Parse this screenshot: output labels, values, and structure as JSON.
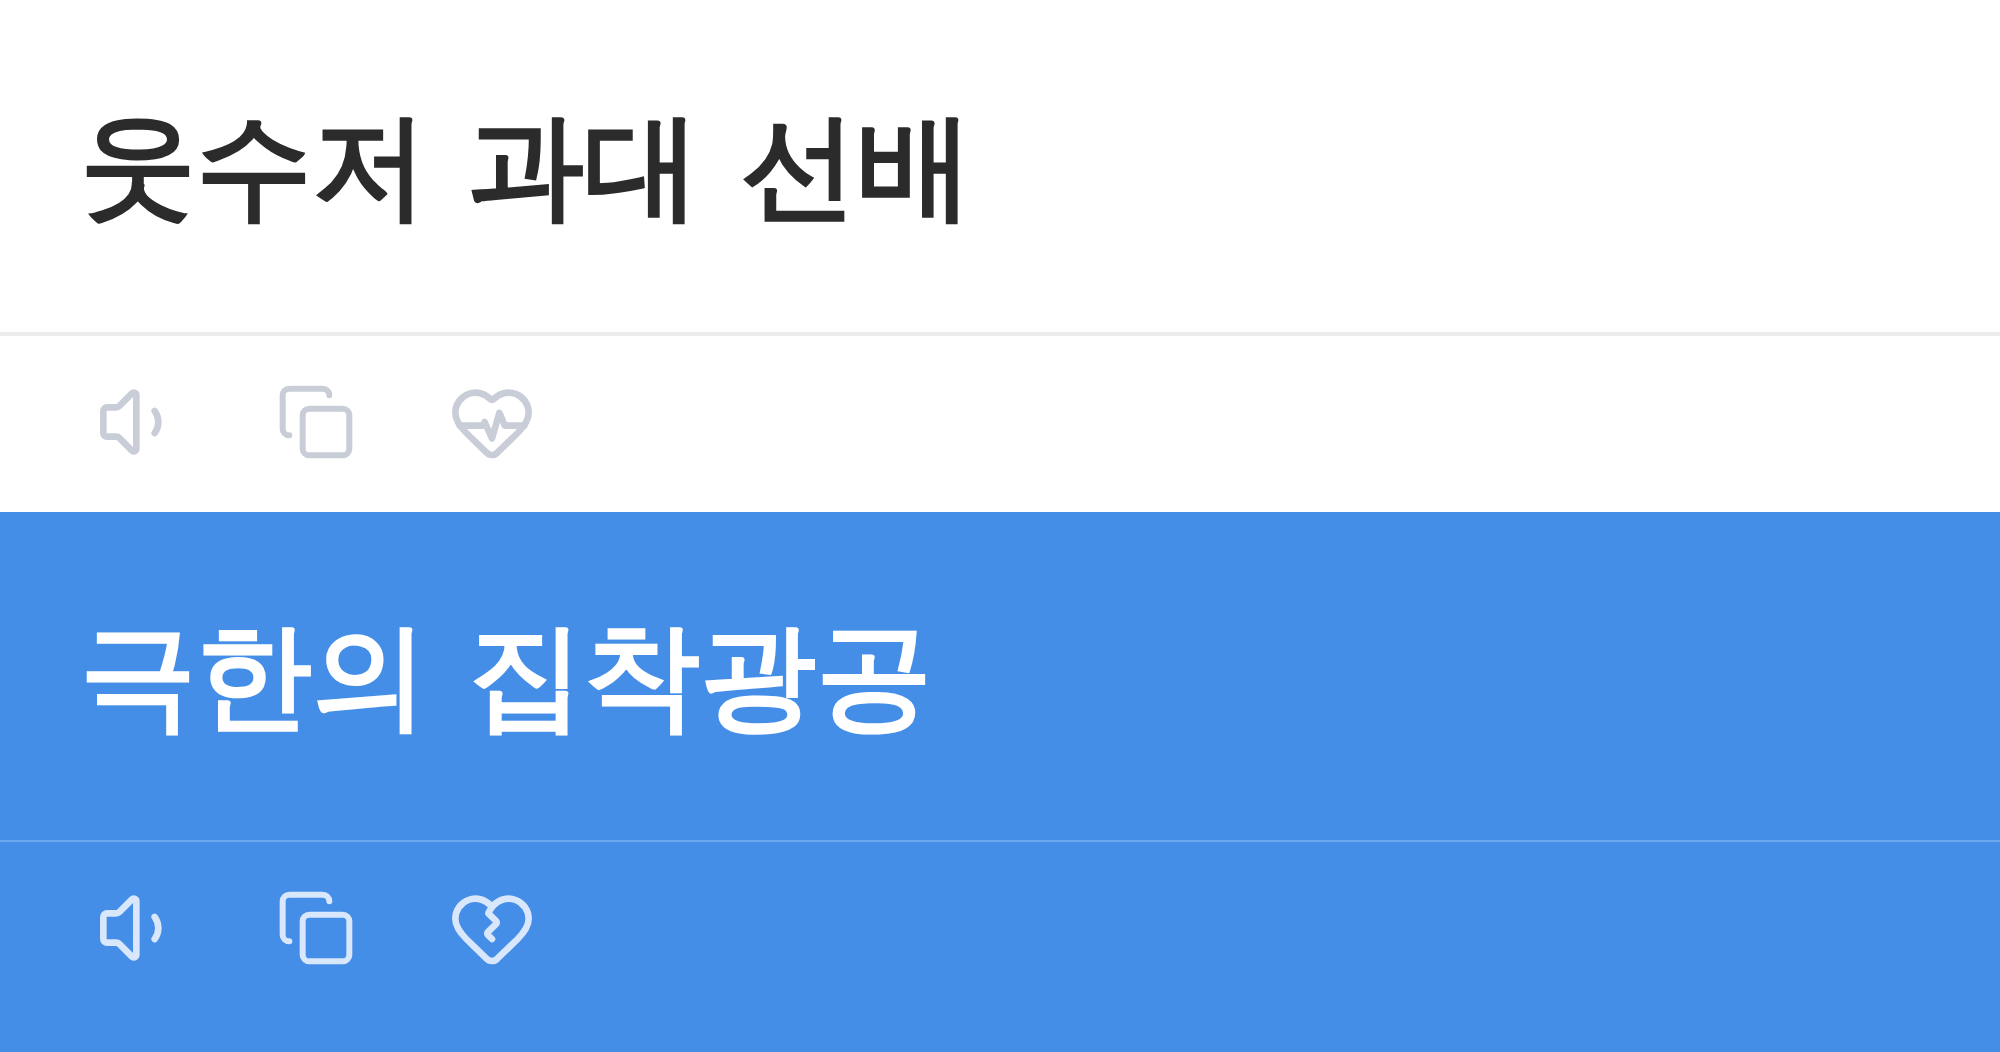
{
  "cards": [
    {
      "title": "웃수저 과대 선배",
      "selected": false
    },
    {
      "title": "극한의 집착광공",
      "selected": true
    }
  ]
}
